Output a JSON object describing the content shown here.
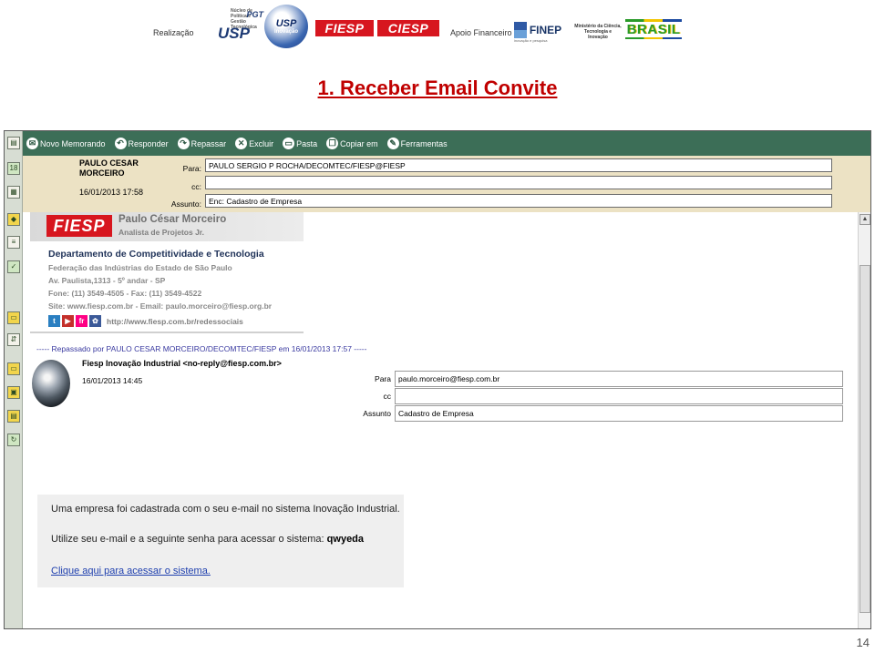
{
  "slide": {
    "title": "1. Receber Email Convite",
    "page_number": "14",
    "logos": {
      "realizacao": "Realização",
      "usp": "USP",
      "pgt": "PGT",
      "pgt_sub": "Núcleo de Política e Gestão Tecnológica",
      "usp_inovacao": "USP",
      "usp_inovacao_sub": "Inovação",
      "fiesp": "FIESP",
      "ciesp": "CIESP",
      "apoio": "Apoio Financeiro",
      "finep": "FINEP",
      "finep_sub": "inovação e pesquisa",
      "mct": "Ministério da Ciência, Tecnologia e Inovação",
      "brasil": "BRASIL"
    }
  },
  "toolbar": {
    "items": [
      {
        "label": "Novo Memorando",
        "icon": "new-memo-icon"
      },
      {
        "label": "Responder",
        "icon": "reply-icon"
      },
      {
        "label": "Repassar",
        "icon": "forward-icon"
      },
      {
        "label": "Excluir",
        "icon": "delete-icon"
      },
      {
        "label": "Pasta",
        "icon": "folder-icon"
      },
      {
        "label": "Copiar em",
        "icon": "copy-icon"
      },
      {
        "label": "Ferramentas",
        "icon": "tools-icon"
      }
    ]
  },
  "sidebar": {
    "icons": [
      "mail-icon",
      "calendar-icon",
      "contacts-icon",
      "todo-icon",
      "notebook-icon",
      "tasks-icon",
      "folder-icon",
      "replication-icon",
      "archive-icon",
      "workspace-icon",
      "database-icon",
      "sync-icon"
    ],
    "calendar_day": "18"
  },
  "message_header": {
    "sender_name": "PAULO CESAR MORCEIRO",
    "sent_date": "16/01/2013 17:58",
    "para_label": "Para:",
    "para_value": "PAULO SERGIO P ROCHA/DECOMTEC/FIESP@FIESP",
    "cc_label": "cc:",
    "cc_value": "",
    "assunto_label": "Assunto:",
    "assunto_value": "Enc: Cadastro de Empresa"
  },
  "signature": {
    "logo": "FIESP",
    "name": "Paulo César Morceiro",
    "role": "Analista de Projetos Jr.",
    "department": "Departamento de Competitividade e Tecnologia",
    "federation": "Federação das Indústrias do Estado de São Paulo",
    "address": "Av. Paulista,1313 - 5º andar - SP",
    "phone": "Fone: (11) 3549-4505 - Fax: (11) 3549-4522",
    "site": "Site: www.fiesp.com.br - Email: paulo.morceiro@fiesp.org.br",
    "social_url": "http://www.fiesp.com.br/redessociais"
  },
  "forwarded": {
    "forward_line": "----- Repassado por PAULO CESAR MORCEIRO/DECOMTEC/FIESP em 16/01/2013 17:57 -----",
    "from": "Fiesp Inovação Industrial <no-reply@fiesp.com.br>",
    "date": "16/01/2013 14:45",
    "para_label": "Para",
    "para_value": "paulo.morceiro@fiesp.com.br",
    "cc_label": "cc",
    "cc_value": "",
    "assunto_label": "Assunto",
    "assunto_value": "Cadastro de Empresa"
  },
  "body": {
    "line1": "Uma empresa foi cadastrada com o seu e-mail no sistema Inovação Industrial.",
    "line2": "Utilize seu e-mail e a seguinte senha para acessar o sistema:",
    "password": "qwyeda",
    "link": "Clique aqui para acessar o sistema."
  }
}
